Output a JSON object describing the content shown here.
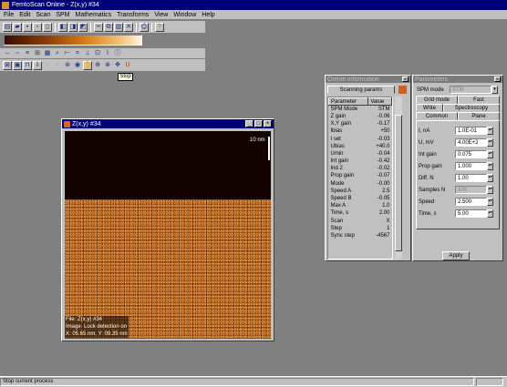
{
  "app": {
    "title": "FemtoScan Online - Z(x,y) #34",
    "menu": [
      "File",
      "Edit",
      "Scan",
      "SPM",
      "Mathematics",
      "Transforms",
      "View",
      "Window",
      "Help"
    ]
  },
  "tooltip": "Stop",
  "statusbar": {
    "text": "Stop current process"
  },
  "image_window": {
    "title": "Z(x,y) #34",
    "scale_label": "10 nm",
    "overlay": [
      "File: Z(x,y) #34",
      "Image: Lock detection on",
      "X: 05.65 nm, Y: 09.35 nm"
    ]
  },
  "info_panel": {
    "title": "Online information",
    "tab_label": "Scanning params",
    "headers": [
      "Parameter",
      "Value"
    ],
    "rows": [
      [
        "SPM Mode",
        "STM"
      ],
      [
        "Z gain",
        "-0.06"
      ],
      [
        "X,Y gain",
        "-0.17"
      ],
      [
        "Ibias",
        "+50"
      ],
      [
        "I set",
        "-0.03"
      ],
      [
        "Ubias",
        "+40.0"
      ],
      [
        "Umin",
        "-0.04"
      ],
      [
        "Int gain",
        "-0.42"
      ],
      [
        "Ind 2",
        "-0.02"
      ],
      [
        "Prop gain",
        "-0.07"
      ],
      [
        "Mode",
        "-0.00"
      ],
      [
        "Speed A",
        "2.5"
      ],
      [
        "Speed B",
        "-0.05"
      ],
      [
        "Max A",
        "1.0"
      ],
      [
        "Time, s",
        "2.00"
      ],
      [
        "Scan",
        "X"
      ],
      [
        "Step",
        "1"
      ],
      [
        "Sync step",
        "-4567"
      ]
    ]
  },
  "params_panel": {
    "title": "Parameters",
    "spm_mode_label": "SPM mode",
    "spm_mode_value": "STM",
    "tabs_row1": [
      "Grid mode",
      "Fast"
    ],
    "tabs_row2": [
      "Write",
      "Spectroscopy"
    ],
    "tabs_row3": [
      "Common",
      "Plane"
    ],
    "fields": [
      {
        "label": "I, nA",
        "value": "1.0E-01"
      },
      {
        "label": "U, mV",
        "value": "4.00E+2"
      },
      {
        "label": "Int gain",
        "value": "0.075"
      },
      {
        "label": "Prop gain",
        "value": "1.000"
      },
      {
        "label": "Diff. N",
        "value": "1.00"
      },
      {
        "label": "Samples N",
        "value": "100"
      },
      {
        "label": "Speed",
        "value": "2.500"
      },
      {
        "label": "Time, s",
        "value": "5.00"
      }
    ],
    "apply_label": "Apply"
  }
}
